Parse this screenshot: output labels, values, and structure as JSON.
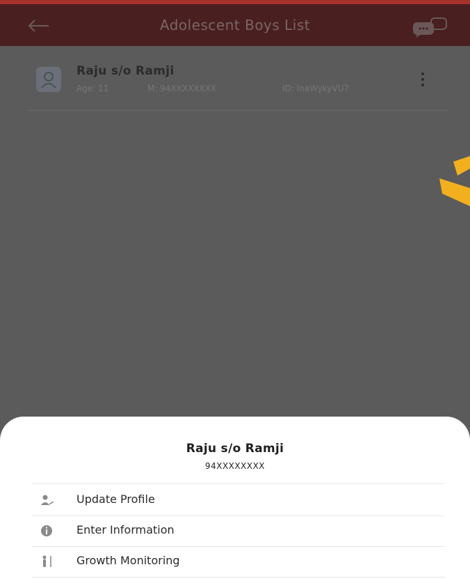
{
  "appbar": {
    "title": "Adolescent Boys List",
    "back_icon": "back-arrow-icon",
    "chat_icon": "chat-bubbles-icon"
  },
  "list": {
    "items": [
      {
        "name": "Raju s/o Ramji",
        "age": "Age: 11",
        "mobile": "M: 94XXXXXXXX",
        "id": "ID: InaWykyVU7",
        "avatar_icon": "person-card-icon",
        "more_icon": "kebab-menu-icon"
      }
    ]
  },
  "sheet": {
    "name": "Raju s/o Ramji",
    "phone": "94XXXXXXXX",
    "menu": [
      {
        "label": "Update Profile",
        "icon": "user-edit-icon"
      },
      {
        "label": "Enter Information",
        "icon": "info-icon"
      },
      {
        "label": "Growth Monitoring",
        "icon": "growth-meter-icon"
      }
    ]
  },
  "colors": {
    "appbar": "#4a1f1f",
    "appbar_accent": "#a6322b",
    "scrim": "#5b5b5b",
    "sheet": "#ffffff",
    "highlight": "#f2b01e"
  }
}
